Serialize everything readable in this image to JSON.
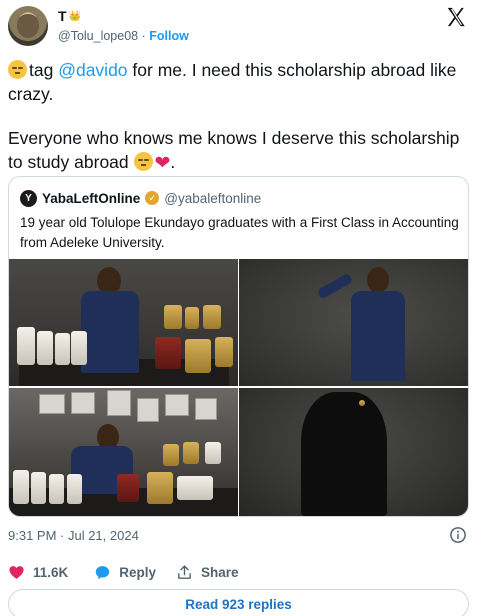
{
  "author": {
    "display_name": "T",
    "handle": "@Tolu_lope08",
    "follow_label": "Follow",
    "separator": "·"
  },
  "tweet": {
    "line1_pre": "tag ",
    "mention": "@davido",
    "line1_post": " for me. I need this scholarship abroad like crazy.",
    "line2": "Everyone who knows me knows I deserve this scholarship to study abroad ",
    "line2_end": "."
  },
  "quote": {
    "avatar_letter": "Y",
    "name": "YabaLeftOnline",
    "handle": "@yabaleftonline",
    "text": "19 year old Tolulope Ekundayo graduates with a First Class in Accounting from Adeleke University."
  },
  "meta": {
    "timestamp": "9:31 PM · Jul 21, 2024"
  },
  "actions": {
    "likes": "11.6K",
    "reply": "Reply",
    "share": "Share",
    "read_replies": "Read 923 replies"
  },
  "colors": {
    "accent": "#1d9bf0",
    "like": "#e0245e",
    "muted": "#536471",
    "border": "#cfd9de"
  },
  "icons": [
    "x-logo-icon",
    "verified-badge-icon",
    "info-icon",
    "heart-icon",
    "reply-bubble-icon",
    "share-icon",
    "crown-icon"
  ]
}
